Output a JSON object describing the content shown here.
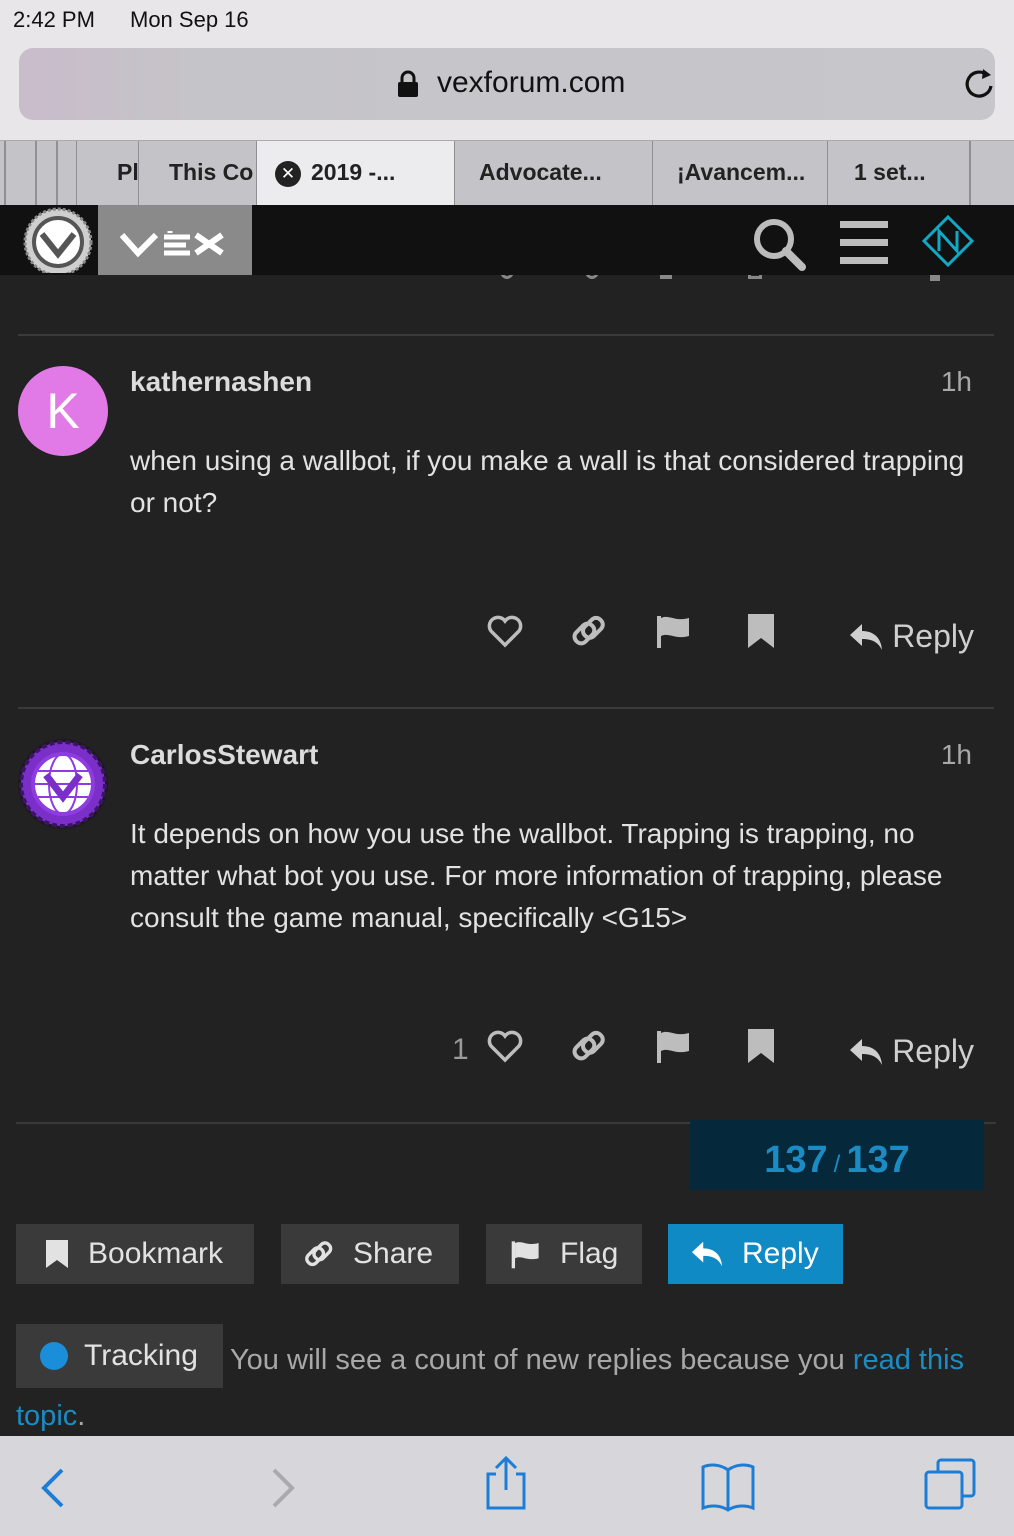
{
  "status_bar": {
    "time": "2:42 PM",
    "date": "Mon Sep 16"
  },
  "browser": {
    "url": "vexforum.com",
    "tabs": [
      {
        "label": "Pl",
        "active": false
      },
      {
        "label": "This Co",
        "active": false
      },
      {
        "label": "2019 -...",
        "active": true
      },
      {
        "label": "Advocate...",
        "active": false
      },
      {
        "label": "¡Avancem...",
        "active": false
      },
      {
        "label": "1 set...",
        "active": false
      }
    ]
  },
  "forum": {
    "logo_text": "VEX",
    "posts": [
      {
        "username": "kathernashen",
        "avatar_letter": "K",
        "date": "1h",
        "body": "when using a wallbot, if you make a wall is that considered trapping or not?",
        "likes": "",
        "reply_label": "Reply"
      },
      {
        "username": "CarlosStewart",
        "date": "1h",
        "body": "It depends on how you use the wallbot. Trapping is trapping, no matter what bot you use. For more information of trapping, please consult the game manual, specifically <G15>",
        "likes": "1",
        "reply_label": "Reply"
      }
    ],
    "progress": {
      "current": "137",
      "separator": "/",
      "total": "137"
    },
    "footer_buttons": {
      "bookmark": "Bookmark",
      "share": "Share",
      "flag": "Flag",
      "reply": "Reply"
    },
    "notification": {
      "level": "Tracking",
      "text": "You will see a count of new replies because you ",
      "link": "read this topic",
      "end": "."
    }
  },
  "colors": {
    "accent": "#0f8ac4",
    "background": "#222222",
    "avatar_k": "#e17ae6"
  }
}
